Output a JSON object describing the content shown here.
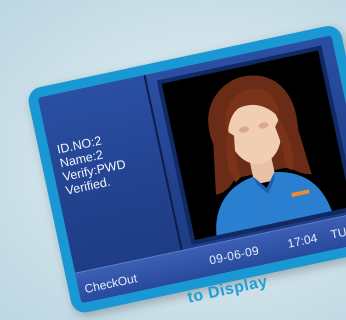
{
  "caption": "to Display",
  "info": {
    "id_line": "ID.NO:2",
    "name_line": "Name:2",
    "verify_line": "Verify:PWD",
    "status_line": "Verified."
  },
  "status_bar": {
    "mode": "CheckOut",
    "date": "09-06-09",
    "time": "17:04",
    "day": "TU"
  },
  "colors": {
    "device_frame": "#1a98d3",
    "screen": "#22418d",
    "photo_bg": "#000000",
    "shirt": "#2b7fd0",
    "badge": "#f08a2a",
    "caption": "#1e9fd8"
  },
  "icons": {
    "user_photo": "user-portrait"
  }
}
